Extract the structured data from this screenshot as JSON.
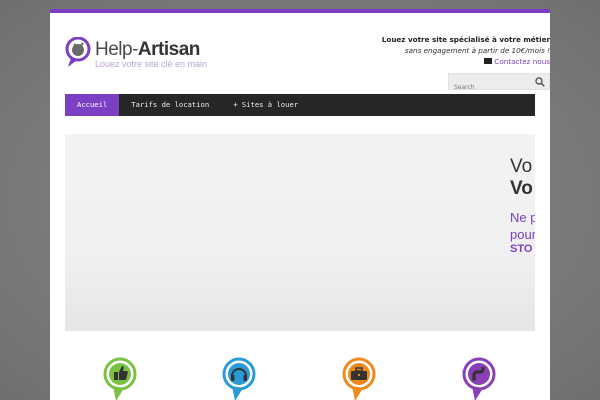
{
  "brand": {
    "name_part1": "Help-",
    "name_part2": "Artisan",
    "tagline": "Louez votre site clé en main",
    "accent_color": "#7b3fc4"
  },
  "promo": {
    "title": "Louez votre site spécialisé à votre métier",
    "subtitle": "sans engagement à partir de 10€/mois !",
    "contact": "Contactez nous"
  },
  "search": {
    "placeholder": "Search"
  },
  "nav": {
    "items": [
      {
        "label": "Accueil"
      },
      {
        "label": "Tarifs de location"
      },
      {
        "label": "+ Sites à louer"
      }
    ]
  },
  "hero": {
    "line1": "Vo",
    "line2": "Vo",
    "line3": "Ne p",
    "line4": "pour",
    "line5": "STO"
  },
  "category_pins": [
    {
      "icon": "thumbs-up-icon",
      "color": "#7bc142"
    },
    {
      "icon": "headset-icon",
      "color": "#2a9bd6"
    },
    {
      "icon": "toolbox-icon",
      "color": "#f08a1c"
    },
    {
      "icon": "pipe-icon",
      "color": "#8a3fb6"
    }
  ]
}
